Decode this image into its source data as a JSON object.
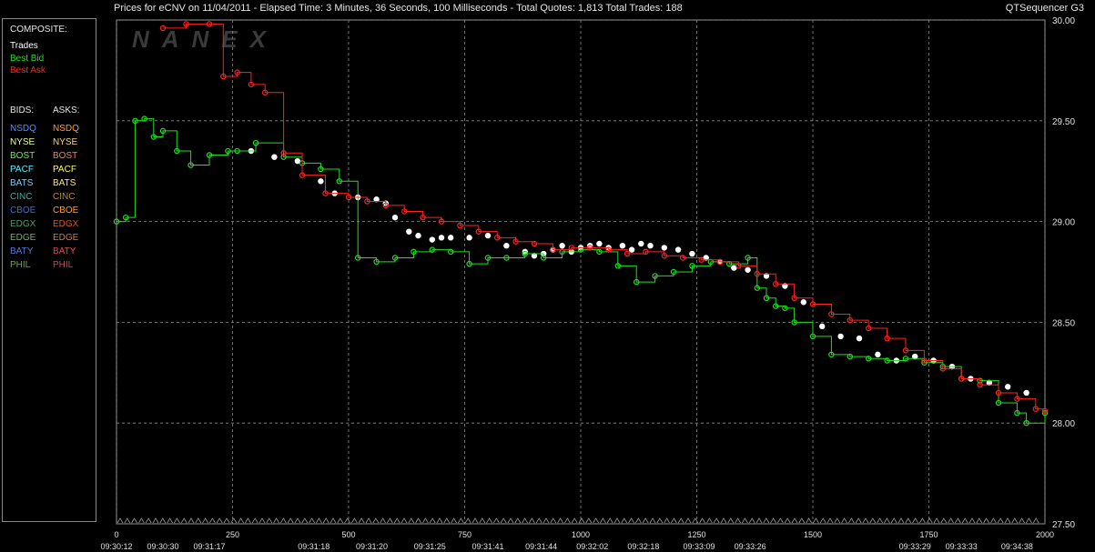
{
  "header": {
    "title": "Prices for  eCNV  on  11/04/2011  -  Elapsed Time: 3 Minutes, 36 Seconds, 100 Milliseconds  -  Total Quotes: 1,813  Total Trades: 188",
    "app_name": "QTSequencer G3",
    "watermark": "NANEX"
  },
  "legend": {
    "composite_heading": "COMPOSITE:",
    "composite": [
      {
        "label": "Trades",
        "color": "#ffffff"
      },
      {
        "label": "Best Bid",
        "color": "#22dd22"
      },
      {
        "label": "Best Ask",
        "color": "#ff2222"
      }
    ],
    "bids_heading": "BIDS:",
    "asks_heading": "ASKS:",
    "exchanges": [
      {
        "bid": "NSDQ",
        "ask": "NSDQ",
        "bid_color": "#4a90ff",
        "ask_color": "#ff9a3c"
      },
      {
        "bid": "NYSE",
        "ask": "NYSE",
        "bid_color": "#e8ff9a",
        "ask_color": "#ffd27a"
      },
      {
        "bid": "BOST",
        "ask": "BOST",
        "bid_color": "#7fe070",
        "ask_color": "#ff7a5a"
      },
      {
        "bid": "PACF",
        "ask": "PACF",
        "bid_color": "#5ef0ff",
        "ask_color": "#ffff55"
      },
      {
        "bid": "BATS",
        "ask": "BATS",
        "bid_color": "#7ad0ff",
        "ask_color": "#ffe97a"
      },
      {
        "bid": "CINC",
        "ask": "CINC",
        "bid_color": "#4aa8a0",
        "ask_color": "#b08a50"
      },
      {
        "bid": "CBOE",
        "ask": "CBOE",
        "bid_color": "#3a6ad8",
        "ask_color": "#ff9a3c"
      },
      {
        "bid": "EDGX",
        "ask": "EDGX",
        "bid_color": "#4aa070",
        "ask_color": "#d05a2a"
      },
      {
        "bid": "EDGE",
        "ask": "EDGE",
        "bid_color": "#7ab060",
        "ask_color": "#c87a5a"
      },
      {
        "bid": "BATY",
        "ask": "BATY",
        "bid_color": "#5a7ad8",
        "ask_color": "#e04a4a"
      },
      {
        "bid": "PHIL",
        "ask": "PHIL",
        "bid_color": "#7aa05a",
        "ask_color": "#c04a5a"
      }
    ]
  },
  "chart_data": {
    "type": "line",
    "ylim": [
      27.5,
      30.0
    ],
    "yticks": [
      "30.00",
      "29.50",
      "29.00",
      "28.50",
      "28.00",
      "27.50"
    ],
    "xlim": [
      0,
      2000
    ],
    "xticks": [
      0,
      250,
      500,
      750,
      1000,
      1250,
      1500,
      1750,
      2000
    ],
    "time_labels": [
      {
        "seq": 0,
        "label": "09:30:12"
      },
      {
        "seq": 100,
        "label": "09:30:30"
      },
      {
        "seq": 200,
        "label": "09:31:17"
      },
      {
        "seq": 425,
        "label": "09:31:18"
      },
      {
        "seq": 550,
        "label": "09:31:20"
      },
      {
        "seq": 675,
        "label": "09:31:25"
      },
      {
        "seq": 800,
        "label": "09:31:41"
      },
      {
        "seq": 915,
        "label": "09:31:44"
      },
      {
        "seq": 1025,
        "label": "09:32:02"
      },
      {
        "seq": 1135,
        "label": "09:32:18"
      },
      {
        "seq": 1255,
        "label": "09:33:09"
      },
      {
        "seq": 1365,
        "label": "09:33:26"
      },
      {
        "seq": 1720,
        "label": "09:33:29"
      },
      {
        "seq": 1820,
        "label": "09:33:33"
      },
      {
        "seq": 1940,
        "label": "09:34:38"
      }
    ],
    "grid": true,
    "series": [
      {
        "name": "Trades",
        "color": "#ffffff",
        "x": [
          290,
          340,
          390,
          440,
          470,
          520,
          560,
          580,
          600,
          630,
          650,
          680,
          700,
          720,
          760,
          800,
          840,
          880,
          900,
          920,
          940,
          960,
          980,
          1000,
          1020,
          1040,
          1060,
          1090,
          1110,
          1130,
          1150,
          1180,
          1210,
          1240,
          1270,
          1300,
          1330,
          1360,
          1400,
          1440,
          1480,
          1520,
          1560,
          1600,
          1640,
          1680,
          1720,
          1760,
          1800,
          1840,
          1880,
          1920,
          1960
        ],
        "y": [
          29.35,
          29.32,
          29.3,
          29.2,
          29.14,
          29.12,
          29.11,
          29.09,
          29.02,
          28.95,
          28.93,
          28.91,
          28.92,
          28.92,
          28.92,
          28.93,
          28.88,
          28.85,
          28.83,
          28.84,
          28.86,
          28.88,
          28.85,
          28.87,
          28.88,
          28.89,
          28.87,
          28.88,
          28.86,
          28.89,
          28.88,
          28.87,
          28.86,
          28.84,
          28.82,
          28.8,
          28.77,
          28.76,
          28.73,
          28.68,
          28.6,
          28.48,
          28.43,
          28.42,
          28.34,
          28.31,
          28.33,
          28.31,
          28.28,
          28.22,
          28.2,
          28.18,
          28.15
        ]
      },
      {
        "name": "Best Bid",
        "color": "#22dd22",
        "x": [
          0,
          20,
          40,
          60,
          80,
          100,
          130,
          160,
          200,
          240,
          260,
          300,
          360,
          400,
          440,
          480,
          520,
          560,
          600,
          640,
          680,
          720,
          760,
          800,
          840,
          880,
          920,
          960,
          1000,
          1040,
          1080,
          1120,
          1160,
          1200,
          1240,
          1280,
          1320,
          1360,
          1380,
          1400,
          1420,
          1440,
          1460,
          1500,
          1540,
          1580,
          1620,
          1660,
          1700,
          1740,
          1780,
          1820,
          1860,
          1900,
          1940,
          1960,
          2000
        ],
        "y": [
          29.0,
          29.02,
          29.5,
          29.51,
          29.42,
          29.45,
          29.35,
          29.28,
          29.33,
          29.35,
          29.35,
          29.39,
          29.32,
          29.29,
          29.26,
          29.2,
          28.82,
          28.8,
          28.82,
          28.85,
          28.86,
          28.85,
          28.79,
          28.82,
          28.82,
          28.84,
          28.82,
          28.85,
          28.86,
          28.85,
          28.78,
          28.7,
          28.73,
          28.75,
          28.78,
          28.8,
          28.79,
          28.82,
          28.67,
          28.62,
          28.58,
          28.57,
          28.5,
          28.43,
          28.34,
          28.33,
          28.32,
          28.31,
          28.32,
          28.3,
          28.28,
          28.22,
          28.21,
          28.1,
          28.05,
          28.0,
          28.05
        ]
      },
      {
        "name": "Best Ask",
        "color": "#ff2222",
        "x": [
          100,
          150,
          200,
          230,
          260,
          290,
          320,
          360,
          400,
          450,
          500,
          540,
          580,
          620,
          660,
          700,
          740,
          780,
          820,
          860,
          900,
          940,
          980,
          1020,
          1060,
          1100,
          1140,
          1180,
          1220,
          1260,
          1300,
          1340,
          1380,
          1420,
          1460,
          1500,
          1540,
          1580,
          1620,
          1660,
          1700,
          1740,
          1780,
          1820,
          1860,
          1900,
          1940,
          1980,
          2000
        ],
        "y": [
          29.96,
          29.98,
          29.98,
          29.72,
          29.74,
          29.68,
          29.64,
          29.34,
          29.23,
          29.14,
          29.12,
          29.1,
          29.08,
          29.05,
          29.02,
          29.0,
          28.98,
          28.95,
          28.92,
          28.9,
          28.89,
          28.86,
          28.87,
          28.87,
          28.86,
          28.84,
          28.85,
          28.83,
          28.82,
          28.81,
          28.8,
          28.78,
          28.74,
          28.69,
          28.62,
          28.59,
          28.54,
          28.51,
          28.47,
          28.42,
          28.36,
          28.31,
          28.27,
          28.22,
          28.19,
          28.15,
          28.12,
          28.07,
          28.06
        ]
      }
    ]
  }
}
